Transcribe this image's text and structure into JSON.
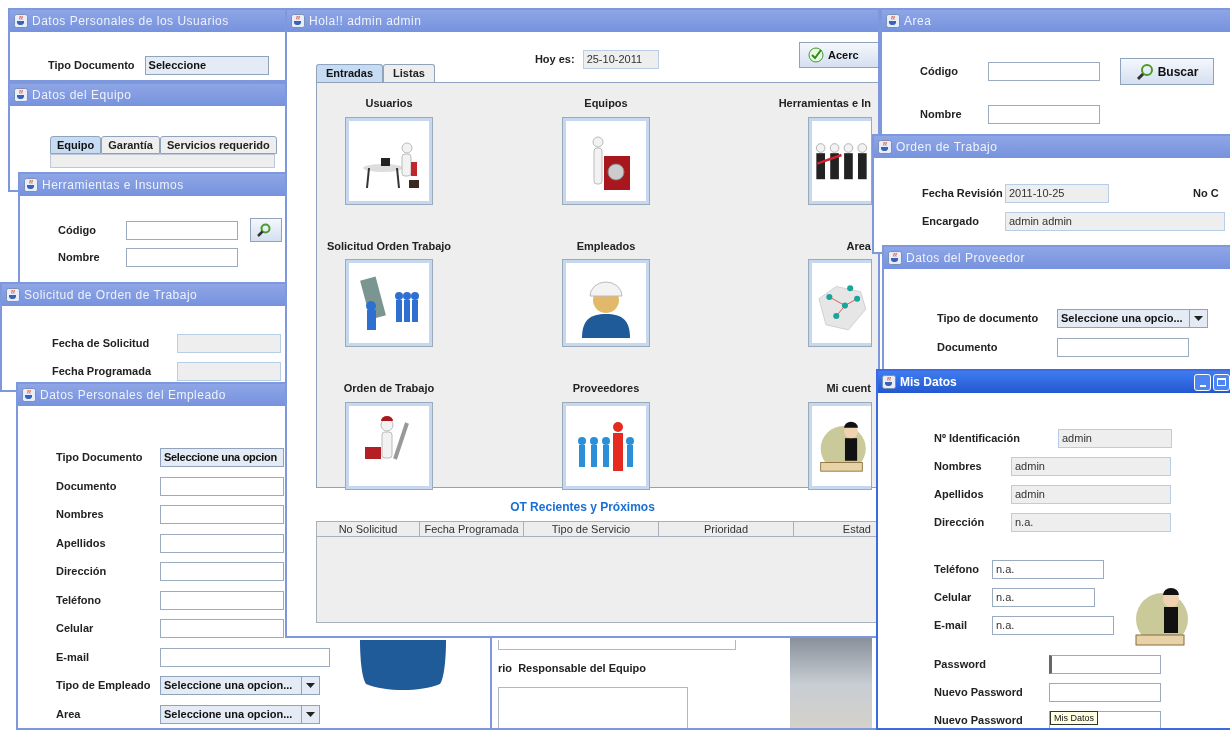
{
  "usuarios_window": {
    "title": "Datos Personales de los Usuarios",
    "field_label": "Tipo Documento",
    "select_value": "Seleccione"
  },
  "equipo_window": {
    "title": "Datos del Equipo",
    "tabs": [
      {
        "label": "Equipo",
        "selected": true
      },
      {
        "label": "Garantía",
        "selected": false
      },
      {
        "label": "Servicios requerido",
        "selected": false
      }
    ]
  },
  "herramientas_window": {
    "title": "Herramientas e Insumos",
    "fields": [
      {
        "label": "Código"
      },
      {
        "label": "Nombre"
      }
    ]
  },
  "solicitud_window": {
    "title": "Solicitud de Orden de Trabajo",
    "fields": [
      {
        "label": "Fecha de Solicitud"
      },
      {
        "label": "Fecha Programada"
      }
    ]
  },
  "empleado_window": {
    "title": "Datos Personales del Empleado",
    "fields": [
      {
        "label": "Tipo Documento",
        "kind": "select",
        "value": "Seleccione una opcion"
      },
      {
        "label": "Documento",
        "kind": "text"
      },
      {
        "label": "Nombres",
        "kind": "text"
      },
      {
        "label": "Apellidos",
        "kind": "text"
      },
      {
        "label": "Dirección",
        "kind": "text"
      },
      {
        "label": "Teléfono",
        "kind": "text"
      },
      {
        "label": "Celular",
        "kind": "text"
      },
      {
        "label": "E-mail",
        "kind": "text"
      },
      {
        "label": "Tipo de Empleado",
        "kind": "select",
        "value": "Seleccione una opcion..."
      },
      {
        "label": "Area",
        "kind": "select",
        "value": "Seleccione una opcion..."
      }
    ]
  },
  "responsable_window": {
    "label": "rio  Responsable del Equipo"
  },
  "main_window": {
    "title": "Hola!! admin admin",
    "date_label": "Hoy es:",
    "date_value": "25-10-2011",
    "about_button": "Acerc",
    "tabs": [
      {
        "label": "Entradas",
        "selected": true
      },
      {
        "label": "Listas",
        "selected": false
      }
    ],
    "modules": [
      {
        "label": "Usuarios",
        "kind": "desk"
      },
      {
        "label": "Equipos",
        "kind": "washer"
      },
      {
        "label": "Herramientas e In",
        "kind": "tools"
      },
      {
        "label": "Solicitud Orden Trabajo",
        "kind": "request"
      },
      {
        "label": "Empleados",
        "kind": "worker"
      },
      {
        "label": "Area",
        "kind": "map"
      },
      {
        "label": "Orden de Trabajo",
        "kind": "wrench"
      },
      {
        "label": "Proveedores",
        "kind": "crowd"
      },
      {
        "label": "Mi cuent",
        "kind": "reader"
      }
    ],
    "table": {
      "title": "OT Recientes y Próximos",
      "columns": [
        "No Solicitud",
        "Fecha Programada",
        "Tipo de Servicio",
        "Prioridad",
        "Estad"
      ]
    }
  },
  "area_window": {
    "title": "Area",
    "fields": [
      {
        "label": "Código"
      },
      {
        "label": "Nombre"
      }
    ],
    "search_button": "Buscar"
  },
  "orden_window": {
    "title": "Orden de Trabajo",
    "fields": [
      {
        "label": "Fecha Revisión",
        "value": "2011-10-25"
      },
      {
        "label": "Encargado",
        "value": "admin admin"
      }
    ],
    "cut_label": "No C"
  },
  "proveedor_window": {
    "title": "Datos del Proveedor",
    "fields": [
      {
        "label": "Tipo de documento",
        "kind": "select",
        "value": "Seleccione una opcio..."
      },
      {
        "label": "Documento",
        "kind": "text"
      }
    ]
  },
  "mis_datos_window": {
    "title": "Mis Datos",
    "readonly_fields": [
      {
        "label": "Nº Identificación",
        "value": "admin"
      },
      {
        "label": "Nombres",
        "value": "admin"
      },
      {
        "label": "Apellidos",
        "value": "admin"
      },
      {
        "label": "Dirección",
        "value": "n.a."
      }
    ],
    "contact_fields": [
      {
        "label": "Teléfono",
        "value": "n.a."
      },
      {
        "label": "Celular",
        "value": "n.a."
      },
      {
        "label": "E-mail",
        "value": "n.a."
      }
    ],
    "password_fields": [
      {
        "label": "Password",
        "focused": true
      },
      {
        "label": "Nuevo Password",
        "focused": false
      },
      {
        "label": "Nuevo Password",
        "focused": false
      }
    ],
    "tooltip": "Mis Datos"
  }
}
